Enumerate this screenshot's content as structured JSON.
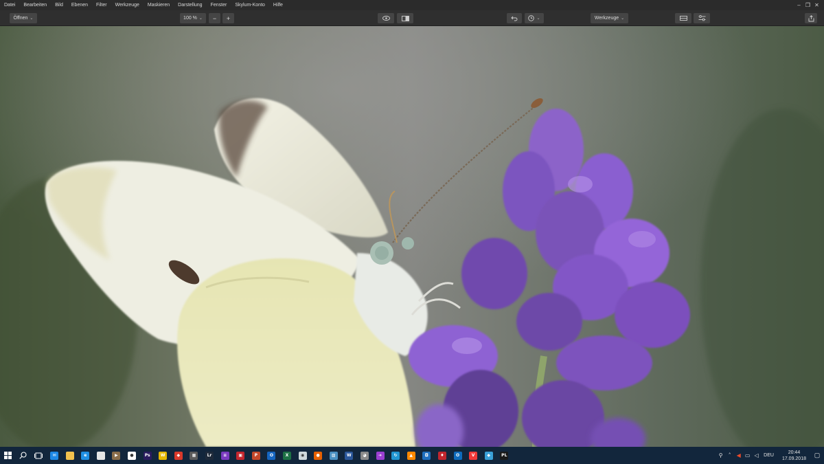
{
  "menubar": {
    "items": [
      "Datei",
      "Bearbeiten",
      "Bild",
      "Ebenen",
      "Filter",
      "Werkzeuge",
      "Maskieren",
      "Darstellung",
      "Fenster",
      "Skylum-Konto",
      "Hilfe"
    ]
  },
  "toolbar": {
    "open_label": "Öffnen",
    "zoom_value": "100 %",
    "zoom_out_symbol": "−",
    "zoom_in_symbol": "+",
    "tools_label": "Werkzeuge"
  },
  "taskbar": {
    "apps": [
      {
        "icon": "folder-icon",
        "color": "#f2c14e",
        "glyph": ""
      },
      {
        "icon": "edge-icon",
        "color": "#1f8fe3",
        "glyph": "e"
      },
      {
        "icon": "store-icon",
        "color": "#e6e6e6",
        "glyph": ""
      },
      {
        "icon": "media-icon",
        "color": "#8a6d4a",
        "glyph": "▶"
      },
      {
        "icon": "panda-icon",
        "color": "#ffffff",
        "glyph": "●"
      },
      {
        "icon": "photoshop-icon",
        "color": "#2a1b5e",
        "glyph": "Ps"
      },
      {
        "icon": "winamp-icon",
        "color": "#e6b800",
        "glyph": "W"
      },
      {
        "icon": "picasa-icon",
        "color": "#d9392b",
        "glyph": "◆"
      },
      {
        "icon": "calculator-icon",
        "color": "#5a5a5a",
        "glyph": "▦"
      },
      {
        "icon": "lightroom-icon",
        "color": "#1e2a3a",
        "glyph": "Lr"
      },
      {
        "icon": "colorstrip-icon",
        "color": "#7a3bbf",
        "glyph": "≡"
      },
      {
        "icon": "presenter-icon",
        "color": "#c4262e",
        "glyph": "▣"
      },
      {
        "icon": "powerpoint-icon",
        "color": "#c5482a",
        "glyph": "P"
      },
      {
        "icon": "outlook-icon",
        "color": "#1565c0",
        "glyph": "O"
      },
      {
        "icon": "excel-icon",
        "color": "#1d7145",
        "glyph": "X"
      },
      {
        "icon": "disc-icon",
        "color": "#cfd8dc",
        "glyph": "◉"
      },
      {
        "icon": "firefox-icon",
        "color": "#e66000",
        "glyph": "●"
      },
      {
        "icon": "image-viewer-icon",
        "color": "#4a90c2",
        "glyph": "▨"
      },
      {
        "icon": "word-icon",
        "color": "#2b579a",
        "glyph": "W"
      },
      {
        "icon": "gimp-icon",
        "color": "#8a8a8a",
        "glyph": "◕"
      },
      {
        "icon": "arrow-app-icon",
        "color": "#9b3fd1",
        "glyph": "➜"
      },
      {
        "icon": "sync-icon",
        "color": "#2196d3",
        "glyph": "↻"
      },
      {
        "icon": "vlc-icon",
        "color": "#ff8800",
        "glyph": "▲"
      },
      {
        "icon": "camera-icon",
        "color": "#1f6fbf",
        "glyph": "◘"
      },
      {
        "icon": "redbird-icon",
        "color": "#c0262e",
        "glyph": "♦"
      },
      {
        "icon": "outlook2-icon",
        "color": "#0f6cbd",
        "glyph": "O"
      },
      {
        "icon": "vivaldi-icon",
        "color": "#ef3939",
        "glyph": "V"
      },
      {
        "icon": "cube-icon",
        "color": "#3aa0d8",
        "glyph": "◆"
      },
      {
        "icon": "pl-icon",
        "color": "#1a1a1a",
        "glyph": "PL"
      }
    ],
    "language": "DEU",
    "time": "20:44",
    "date": "17.09.2018"
  }
}
